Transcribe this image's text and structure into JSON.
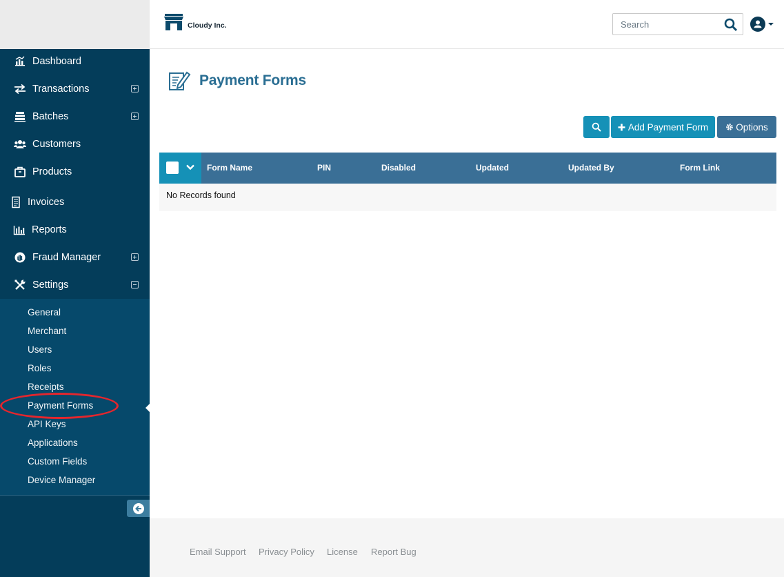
{
  "brand": {
    "name": "Cloudy Inc."
  },
  "search": {
    "placeholder": "Search"
  },
  "sidebar": {
    "items": [
      {
        "label": "Dashboard",
        "icon": "dashboard-icon",
        "expand": "none"
      },
      {
        "label": "Transactions",
        "icon": "transactions-icon",
        "expand": "plus"
      },
      {
        "label": "Batches",
        "icon": "batches-icon",
        "expand": "plus"
      },
      {
        "label": "Customers",
        "icon": "customers-icon",
        "expand": "none"
      },
      {
        "label": "Products",
        "icon": "products-icon",
        "expand": "none"
      },
      {
        "label": "Invoices",
        "icon": "invoices-icon",
        "expand": "none"
      },
      {
        "label": "Reports",
        "icon": "reports-icon",
        "expand": "none"
      },
      {
        "label": "Fraud Manager",
        "icon": "fraud-icon",
        "expand": "plus"
      },
      {
        "label": "Settings",
        "icon": "settings-icon",
        "expand": "minus"
      }
    ],
    "settings_submenu": [
      "General",
      "Merchant",
      "Users",
      "Roles",
      "Receipts",
      "Payment Forms",
      "API Keys",
      "Applications",
      "Custom Fields",
      "Device Manager"
    ],
    "active_submenu": "Payment Forms"
  },
  "page": {
    "title": "Payment Forms",
    "add_button": "Add Payment Form",
    "options_button": "Options"
  },
  "table": {
    "columns": [
      "Form Name",
      "PIN",
      "Disabled",
      "Updated",
      "Updated By",
      "Form Link"
    ],
    "empty_message": "No Records found"
  },
  "footer": {
    "links": [
      "Email Support",
      "Privacy Policy",
      "License",
      "Report Bug"
    ]
  },
  "colors": {
    "sidebar_bg": "#043d5a",
    "submenu_bg": "#06496b",
    "accent": "#1591b7",
    "table_header": "#3a6f96",
    "title": "#2a6e93",
    "highlight": "#e4262d"
  }
}
